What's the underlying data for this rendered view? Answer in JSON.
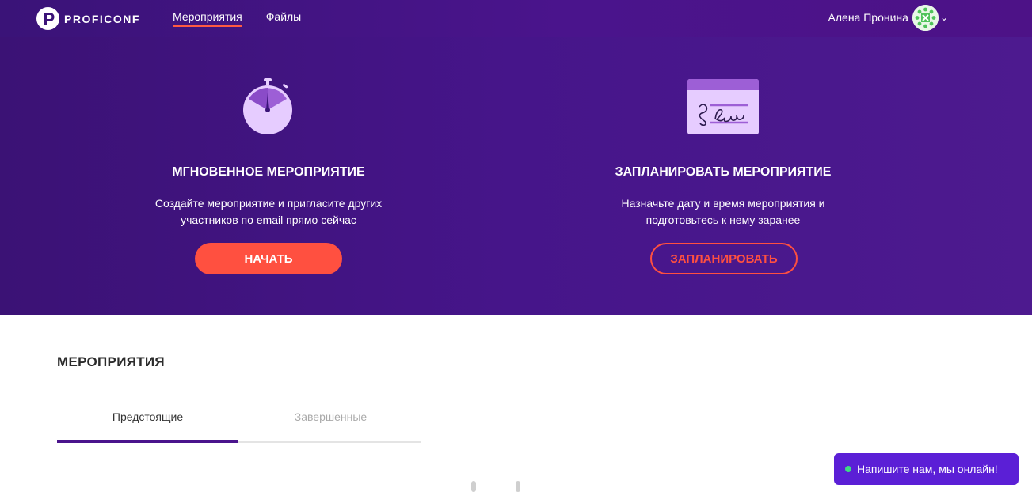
{
  "header": {
    "logo_text": "PROFICONF",
    "nav": [
      {
        "label": "Мероприятия",
        "active": true
      },
      {
        "label": "Файлы",
        "active": false
      }
    ],
    "user_name": "Алена Пронина",
    "chevron": "chevron-down-icon",
    "accent_color": "#ff5a42"
  },
  "hero": {
    "instant": {
      "icon": "stopwatch-icon",
      "title": "Мгновенное мероприятие",
      "description": "Создайте мероприятие и пригласите других участников по email прямо сейчас",
      "button_label": "Начать"
    },
    "scheduled": {
      "icon": "calendar-signature-icon",
      "title": "Запланировать мероприятие",
      "description": "Назначьте дату и время мероприятия и подготовьтесь к нему заранее",
      "button_label": "Запланировать"
    }
  },
  "events": {
    "title": "МЕРОПРИЯТИЯ",
    "tabs": [
      {
        "label": "Предстоящие",
        "active": true
      },
      {
        "label": "Завершенные",
        "active": false
      }
    ]
  },
  "chat": {
    "label": "Напишите нам, мы онлайн!",
    "status_color": "#3ddc84"
  }
}
